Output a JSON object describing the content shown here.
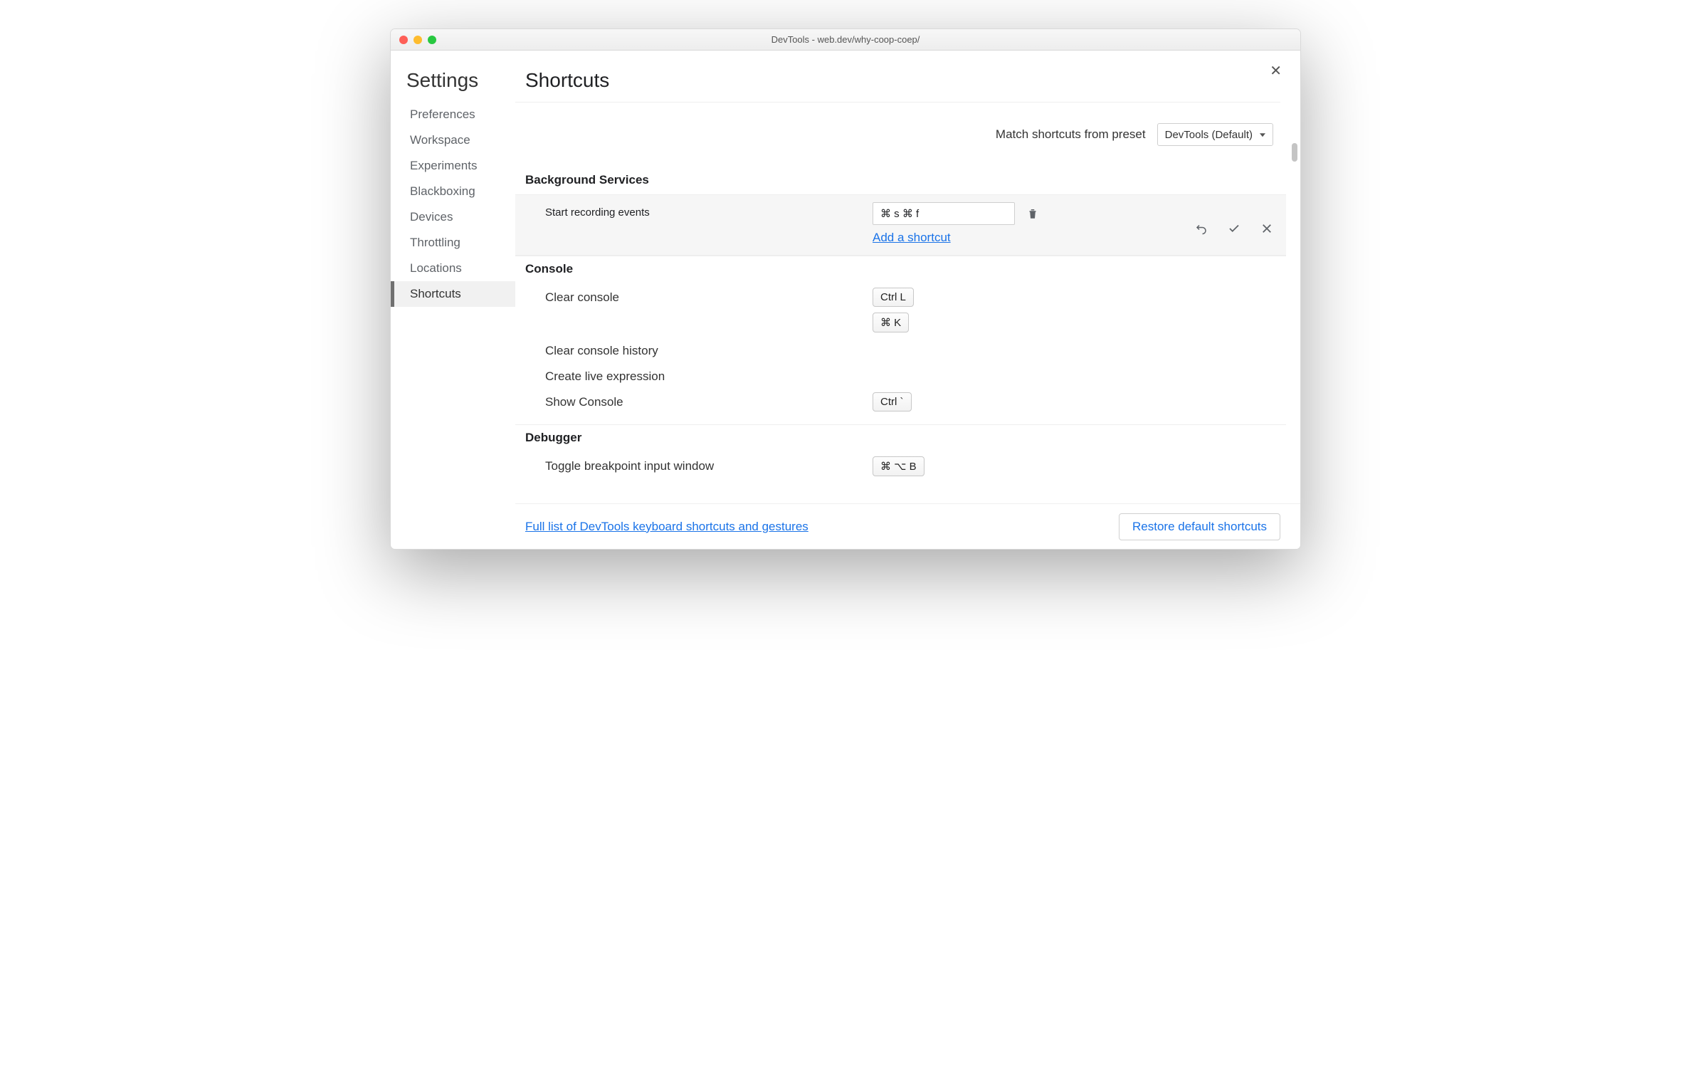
{
  "window": {
    "title": "DevTools - web.dev/why-coop-coep/"
  },
  "sidebar": {
    "title": "Settings",
    "items": [
      {
        "label": "Preferences",
        "active": false
      },
      {
        "label": "Workspace",
        "active": false
      },
      {
        "label": "Experiments",
        "active": false
      },
      {
        "label": "Blackboxing",
        "active": false
      },
      {
        "label": "Devices",
        "active": false
      },
      {
        "label": "Throttling",
        "active": false
      },
      {
        "label": "Locations",
        "active": false
      },
      {
        "label": "Shortcuts",
        "active": true
      }
    ]
  },
  "page": {
    "heading": "Shortcuts",
    "preset_label": "Match shortcuts from preset",
    "preset_value": "DevTools (Default)"
  },
  "sections": {
    "bg": {
      "title": "Background Services",
      "edit": {
        "label": "Start recording events",
        "input_value": "⌘ s ⌘ f",
        "add_link": "Add a shortcut"
      }
    },
    "console": {
      "title": "Console",
      "rows": {
        "clear": {
          "label": "Clear console",
          "keys": [
            "Ctrl L",
            "⌘ K"
          ]
        },
        "history": {
          "label": "Clear console history",
          "keys": []
        },
        "live": {
          "label": "Create live expression",
          "keys": []
        },
        "show": {
          "label": "Show Console",
          "keys": [
            "Ctrl `"
          ]
        }
      }
    },
    "debugger": {
      "title": "Debugger",
      "rows": {
        "toggle_bp": {
          "label": "Toggle breakpoint input window",
          "keys": [
            "⌘ ⌥ B"
          ]
        }
      }
    }
  },
  "footer": {
    "link": "Full list of DevTools keyboard shortcuts and gestures",
    "restore": "Restore default shortcuts"
  }
}
